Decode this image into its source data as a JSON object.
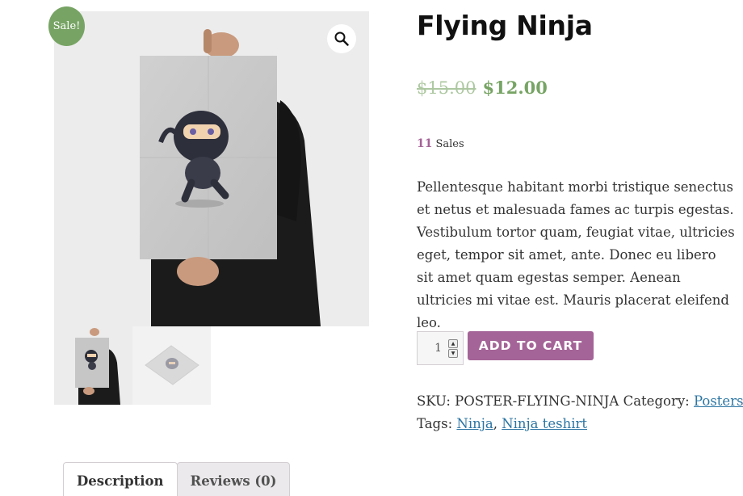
{
  "badge": {
    "sale_label": "Sale!"
  },
  "gallery": {
    "zoom_icon": "magnifier-icon",
    "images": [
      "ninja-poster-held",
      "ninja-poster-flat"
    ]
  },
  "product": {
    "title": "Flying Ninja",
    "price_old": "$15.00",
    "price_new": "$12.00",
    "sales_count": "11",
    "sales_label": "Sales",
    "description": "Pellentesque habitant morbi tristique senectus et netus et malesuada fames ac turpis egestas. Vestibulum tortor quam, feugiat vitae, ultricies eget, tempor sit amet, ante. Donec eu libero sit amet quam egestas semper. Aenean ultricies mi vitae est. Mauris placerat eleifend leo."
  },
  "cart": {
    "quantity": "1",
    "add_label": "ADD TO CART"
  },
  "meta": {
    "sku_label": "SKU:",
    "sku_value": "POSTER-FLYING-NINJA",
    "category_label": "Category:",
    "category": "Posters",
    "tags_label": "Tags:",
    "tags": [
      "Ninja",
      "Ninja teshirt"
    ]
  },
  "tabs": [
    {
      "label": "Description"
    },
    {
      "label": "Reviews (0)"
    }
  ],
  "colors": {
    "sale_green": "#77a464",
    "accent_purple": "#a46497",
    "link_blue": "#2c75a3"
  }
}
